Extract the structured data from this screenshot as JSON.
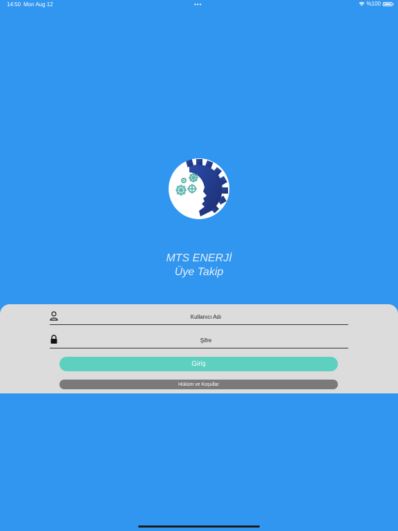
{
  "status_bar": {
    "time": "14:50",
    "date": "Mon Aug 12",
    "dots": "•••",
    "battery": "%100"
  },
  "app": {
    "title_line1": "MTS ENERJİ",
    "title_line2": "Üye Takip"
  },
  "form": {
    "username_placeholder": "Kullanıcı Adı",
    "username_value": "",
    "password_placeholder": "Şifre",
    "password_value": "",
    "login_label": "Giriş",
    "terms_label": "Hüküm ve Koşullar"
  },
  "colors": {
    "background": "#3196F0",
    "panel": "#DCDCDC",
    "login_button": "#5DD0C0",
    "terms_button": "#7A7A7A",
    "logo_navy": "#233C8C",
    "logo_teal": "#5BB5AC"
  },
  "icons": {
    "wifi": "wifi-icon",
    "battery": "battery-icon",
    "user": "user-icon",
    "lock": "lock-icon",
    "logo": "gear-head-logo"
  }
}
